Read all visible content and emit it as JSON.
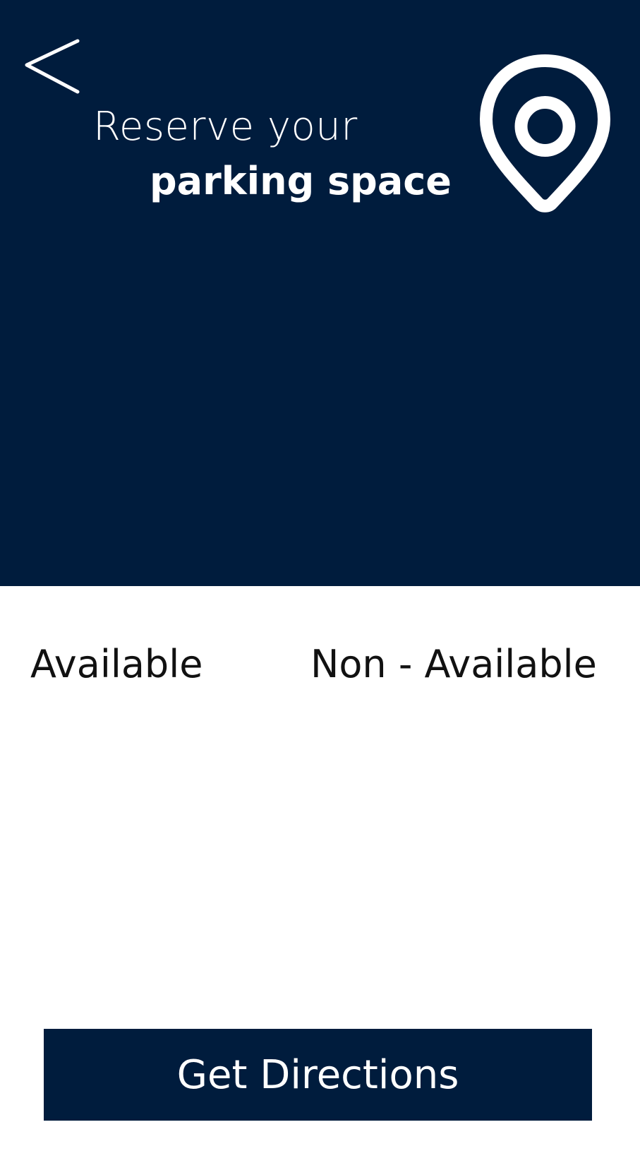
{
  "header": {
    "back_icon": "chevron-left-icon",
    "title_line1": "Reserve your",
    "title_line2": "parking space",
    "location_icon": "map-pin-icon",
    "background_color": "#001c3d"
  },
  "legend": {
    "available_label": "Available",
    "non_available_label": "Non - Available"
  },
  "footer": {
    "directions_button_label": "Get Directions"
  },
  "colors": {
    "brand": "#001c3d",
    "text_on_brand": "#ffffff",
    "body_text": "#111111"
  }
}
